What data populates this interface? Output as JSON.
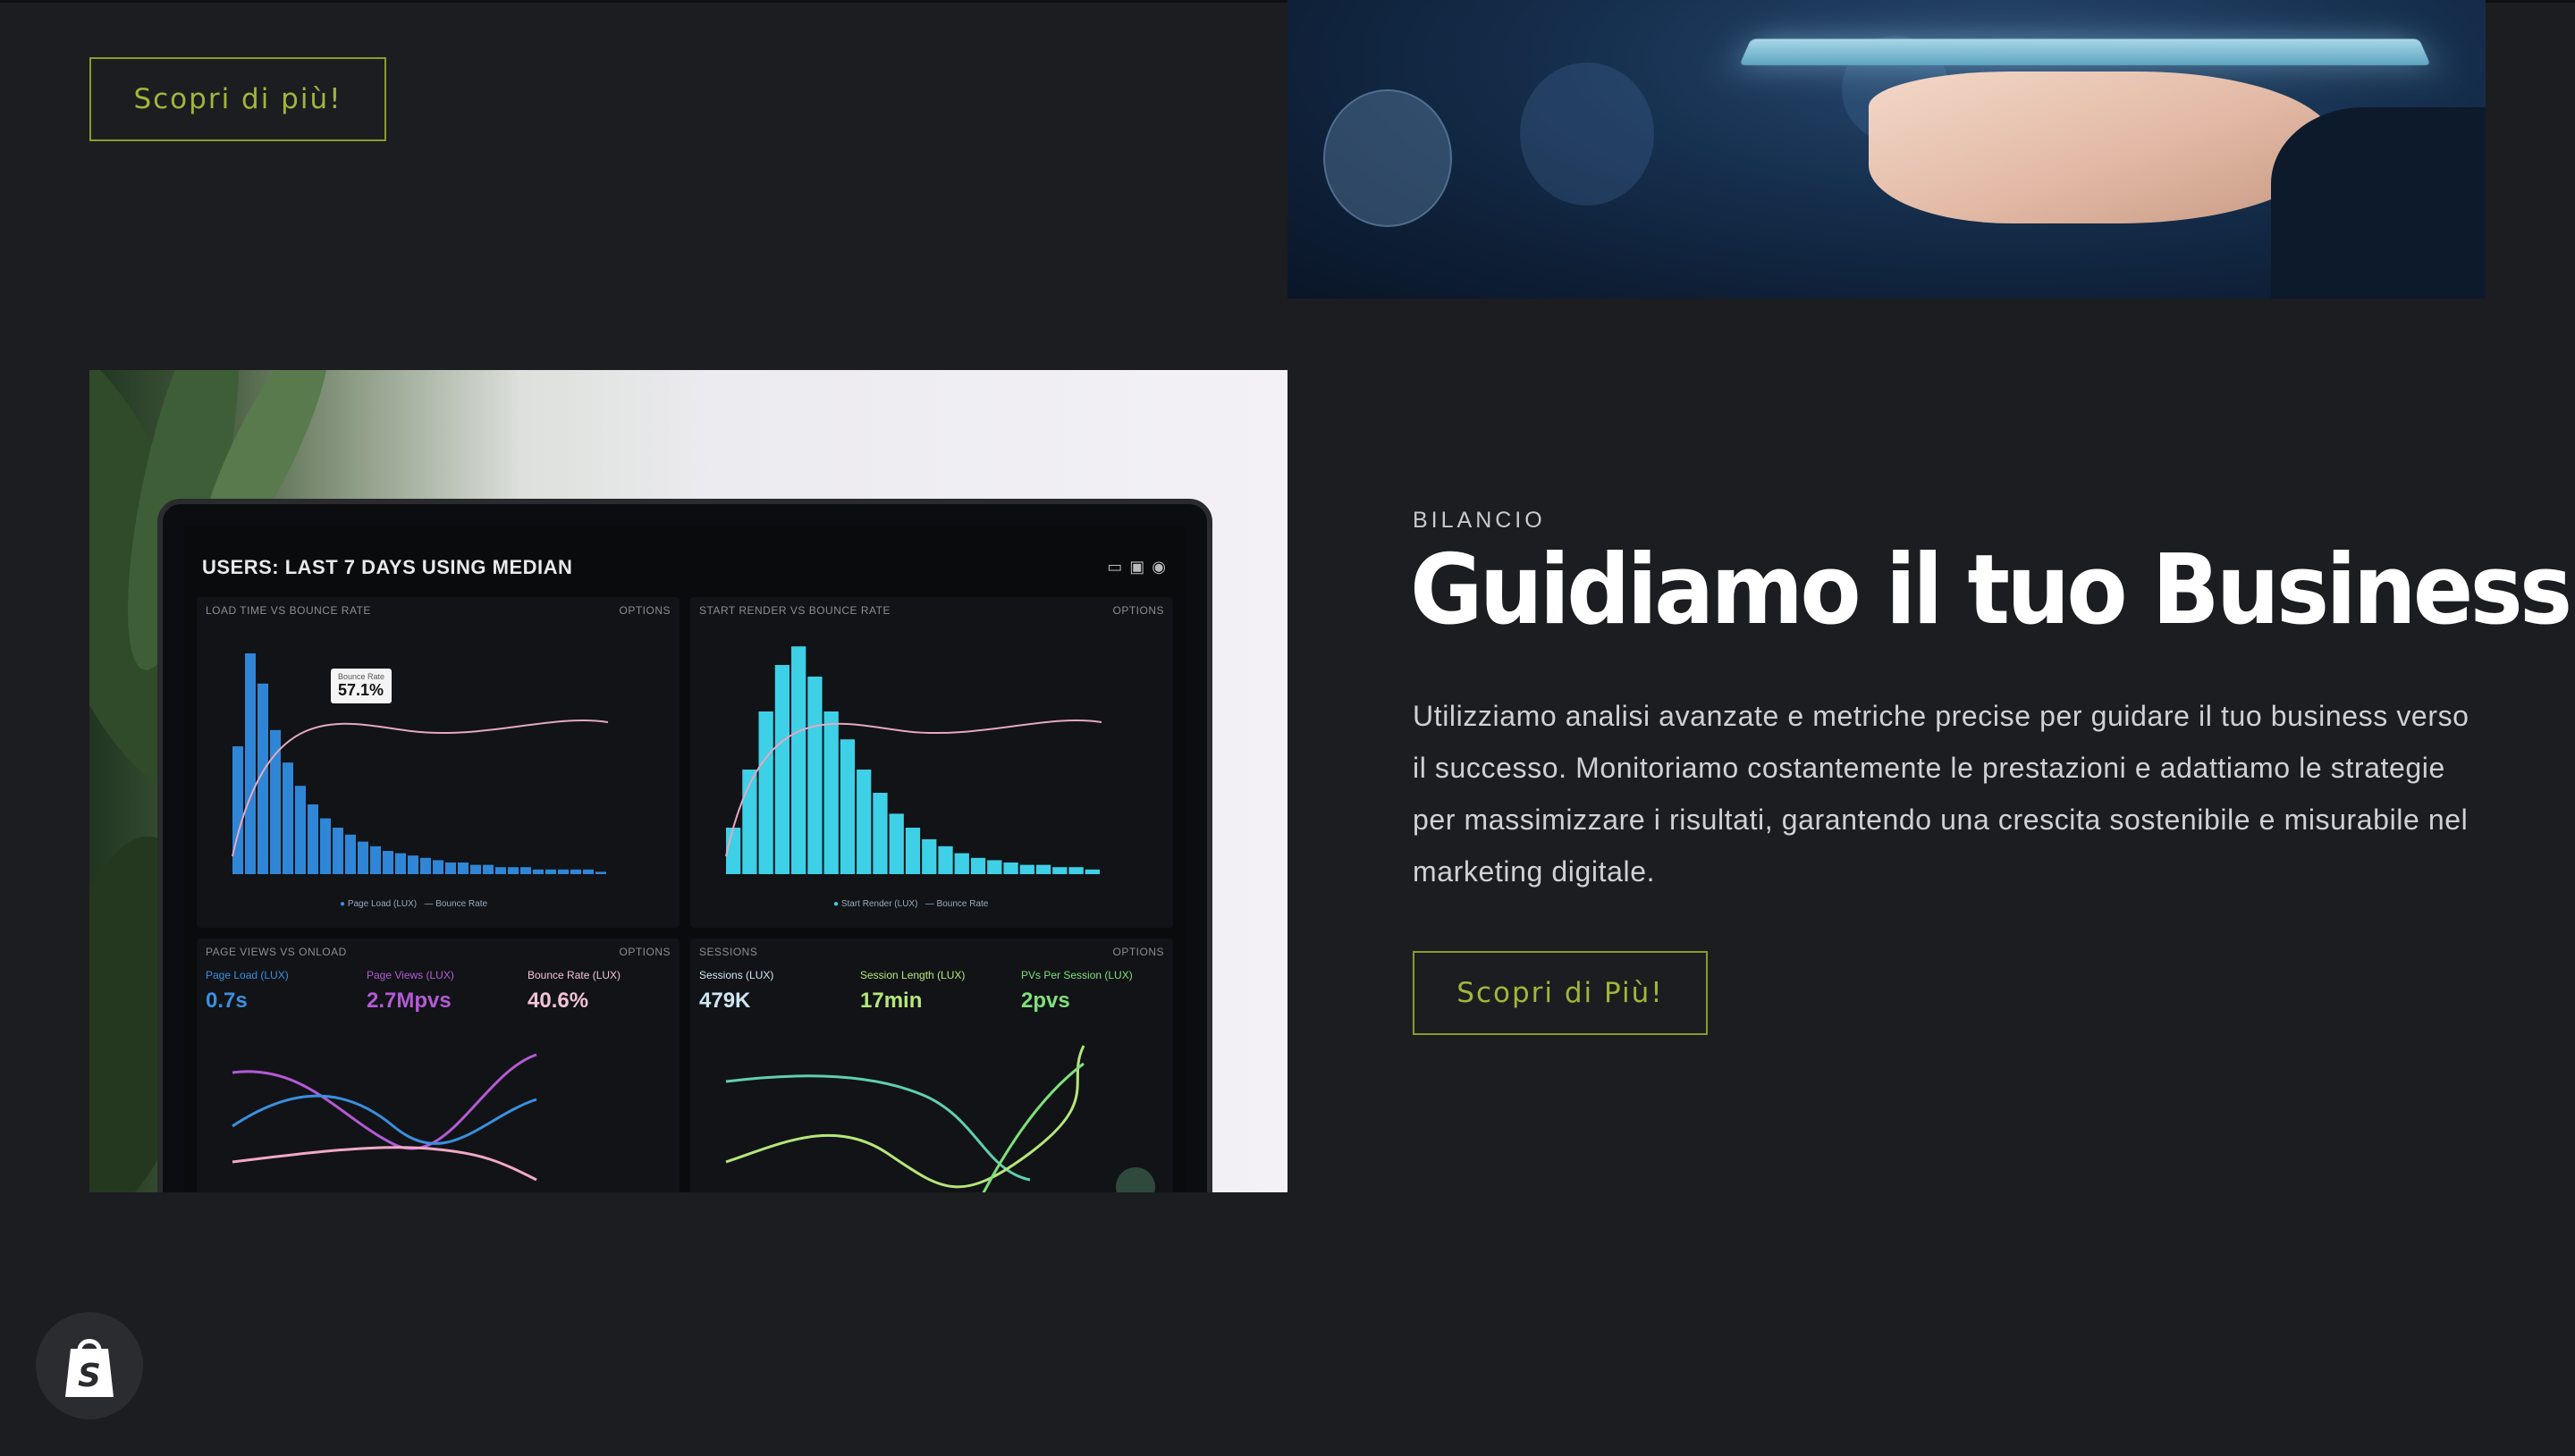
{
  "top_section": {
    "button_label": "Scopri di più!"
  },
  "feature": {
    "eyebrow": "BILANCIO",
    "headline": "Guidiamo il tuo Business",
    "body": "Utilizziamo analisi avanzate e metriche precise per guidare il tuo business verso il successo. Monitoriamo costantemente le prestazioni e adattiamo le strategie per massimizzare i risultati, garantendo una crescita sostenibile e misurabile nel marketing digitale.",
    "button_label": "Scopri di Più!"
  },
  "dashboard_photo": {
    "title": "USERS: LAST 7 DAYS USING MEDIAN",
    "panel1_label": "LOAD TIME VS BOUNCE RATE",
    "panel2_label": "START RENDER VS BOUNCE RATE",
    "panel3_label": "PAGE VIEWS VS ONLOAD",
    "panel4_label": "SESSIONS",
    "options_label": "OPTIONS",
    "tooltip_label": "Bounce Rate",
    "tooltip_value": "57.1%",
    "legend1": [
      "Page Load (LUX)",
      "Bounce Rate"
    ],
    "legend2": [
      "Start Render (LUX)",
      "Bounce Rate"
    ],
    "metrics": [
      {
        "label": "Page Load (LUX)",
        "value": "0.7s",
        "color": "#3b8fe0"
      },
      {
        "label": "Page Views (LUX)",
        "value": "2.7Mpvs",
        "color": "#b45ad6"
      },
      {
        "label": "Bounce Rate (LUX)",
        "value": "40.6%",
        "color": "#f2c2d6"
      },
      {
        "label": "Sessions (LUX)",
        "value": "479K",
        "color": "#cfe6f2"
      },
      {
        "label": "Session Length (LUX)",
        "value": "17min",
        "color": "#b6e67a"
      },
      {
        "label": "PVs Per Session (LUX)",
        "value": "2pvs",
        "color": "#7fe07a"
      }
    ],
    "bars1": [
      0.55,
      0.95,
      0.82,
      0.62,
      0.48,
      0.38,
      0.3,
      0.24,
      0.2,
      0.17,
      0.14,
      0.12,
      0.1,
      0.09,
      0.08,
      0.07,
      0.06,
      0.05,
      0.05,
      0.04,
      0.04,
      0.03,
      0.03,
      0.03,
      0.02,
      0.02,
      0.02,
      0.02,
      0.02,
      0.01
    ],
    "bars2": [
      0.2,
      0.45,
      0.7,
      0.9,
      0.98,
      0.85,
      0.7,
      0.58,
      0.45,
      0.35,
      0.26,
      0.2,
      0.15,
      0.12,
      0.09,
      0.07,
      0.06,
      0.05,
      0.04,
      0.04,
      0.03,
      0.03,
      0.02
    ]
  }
}
